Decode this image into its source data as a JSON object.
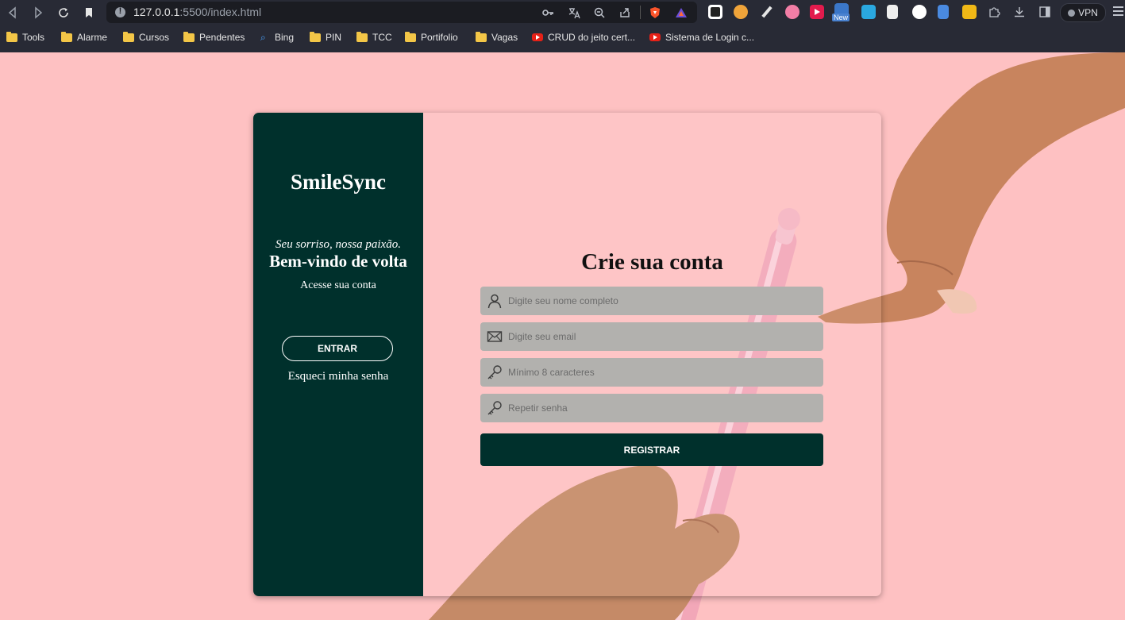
{
  "browser": {
    "url_host": "127.0.0.1",
    "url_path": ":5500/index.html",
    "vpn_label": "VPN",
    "ext_new_badge": "New",
    "bookmarks": [
      {
        "label": "Tools",
        "icon": "folder-icon"
      },
      {
        "label": "Alarme",
        "icon": "folder-icon"
      },
      {
        "label": "Cursos",
        "icon": "folder-icon"
      },
      {
        "label": "Pendentes",
        "icon": "folder-icon"
      },
      {
        "label": "Bing",
        "icon": "search-icon"
      },
      {
        "label": "PIN",
        "icon": "folder-icon"
      },
      {
        "label": "TCC",
        "icon": "folder-icon"
      },
      {
        "label": "Portifolio",
        "icon": "folder-icon"
      },
      {
        "label": "Vagas",
        "icon": "folder-icon"
      },
      {
        "label": "CRUD do jeito cert...",
        "icon": "youtube-icon"
      },
      {
        "label": "Sistema de Login c...",
        "icon": "youtube-icon"
      }
    ]
  },
  "login_panel": {
    "brand": "SmileSync",
    "tagline": "Seu sorriso, nossa paixão.",
    "welcome": "Bem-vindo de volta",
    "subtitle": "Acesse sua conta",
    "enter_label": "ENTRAR",
    "forgot_label": "Esqueci minha senha"
  },
  "register_form": {
    "title": "Crie sua conta",
    "name_placeholder": "Digite seu nome completo",
    "email_placeholder": "Digite seu email",
    "password_placeholder": "Mínimo 8 caracteres",
    "repeat_placeholder": "Repetir senha",
    "register_label": "REGISTRAR"
  },
  "colors": {
    "page_background": "#fec1c2",
    "panel_dark": "#00302c",
    "field_background": "#b2b1ae"
  }
}
